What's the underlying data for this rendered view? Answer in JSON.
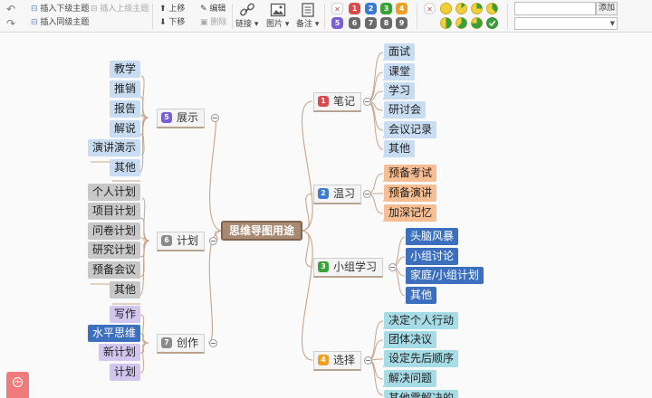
{
  "toolbar": {
    "insert_child": "插入下级主题",
    "insert_parent": "插入上级主题",
    "insert_sibling": "插入同级主题",
    "move_up": "上移",
    "move_down": "下移",
    "edit": "编辑",
    "delete": "删除",
    "link": "链接",
    "image": "图片",
    "note": "备注",
    "add": "添加",
    "priority_badges": [
      {
        "label": "✕",
        "color": "#d84c4c"
      },
      {
        "label": "1",
        "color": "#d84c4c"
      },
      {
        "label": "2",
        "color": "#3b7bd6"
      },
      {
        "label": "3",
        "color": "#3aa13a"
      },
      {
        "label": "4",
        "color": "#f0a020"
      },
      {
        "label": "5",
        "color": "#7a5fd0"
      },
      {
        "label": "6",
        "color": "#6a6a6a"
      },
      {
        "label": "7",
        "color": "#6a6a6a"
      },
      {
        "label": "8",
        "color": "#6a6a6a"
      },
      {
        "label": "9",
        "color": "#6a6a6a"
      }
    ],
    "progress_icons": [
      "clear",
      "0",
      "1/8",
      "2/8",
      "3/8",
      "4/8",
      "5/8",
      "6/8",
      "7/8",
      "done"
    ]
  },
  "mindmap": {
    "root": "思维导图用途",
    "branches": {
      "zhanshi": {
        "label": "展示",
        "badge": "5",
        "color": "#7a5fd0",
        "children": [
          "教学",
          "推销",
          "报告",
          "解说",
          "演讲演示",
          "其他"
        ]
      },
      "jihua": {
        "label": "计划",
        "badge": "6",
        "color": "#8a8a8a",
        "children": [
          "个人计划",
          "项目计划",
          "问卷计划",
          "研究计划",
          "预备会议",
          "其他"
        ]
      },
      "chuangzuo": {
        "label": "创作",
        "badge": "7",
        "color": "#8a8a8a",
        "children": [
          "写作",
          "水平思维",
          "新计划",
          "计划"
        ]
      },
      "biji": {
        "label": "笔记",
        "badge": "1",
        "color": "#d84c4c",
        "children": [
          "面试",
          "课堂",
          "学习",
          "研讨会",
          "会议记录",
          "其他"
        ]
      },
      "wenxi": {
        "label": "温习",
        "badge": "2",
        "color": "#3b7bd6",
        "children": [
          "预备考试",
          "预备演讲",
          "加深记忆"
        ]
      },
      "xiaozu": {
        "label": "小组学习",
        "badge": "3",
        "color": "#3aa13a",
        "children": [
          "头脑风暴",
          "小组讨论",
          "家庭/小组计划",
          "其他"
        ]
      },
      "xuanze": {
        "label": "选择",
        "badge": "4",
        "color": "#f0a020",
        "children": [
          "决定个人行动",
          "团体决议",
          "设定先后顺序",
          "解决问题",
          "其他需解决的"
        ]
      }
    }
  }
}
